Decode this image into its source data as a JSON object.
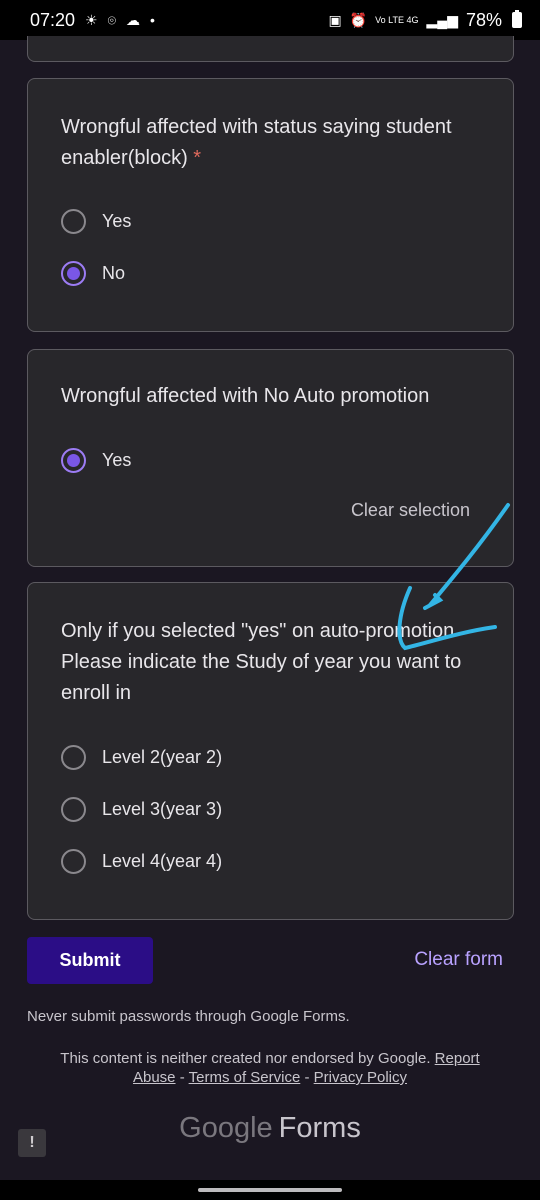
{
  "status_bar": {
    "time": "07:20",
    "network": "Vo LTE 4G",
    "battery": "78%"
  },
  "questions": [
    {
      "title": "Wrongful affected with status saying student enabler(block)",
      "required_mark": "*",
      "options": [
        {
          "label": "Yes",
          "selected": false
        },
        {
          "label": "No",
          "selected": true
        }
      ]
    },
    {
      "title": "Wrongful affected with No Auto promotion",
      "options": [
        {
          "label": "Yes",
          "selected": true
        }
      ],
      "clear_selection": "Clear selection"
    },
    {
      "title": "Only if you selected \"yes\" on auto-promotion Please indicate the Study of year you want to enroll in",
      "options": [
        {
          "label": "Level 2(year 2)",
          "selected": false
        },
        {
          "label": "Level 3(year 3)",
          "selected": false
        },
        {
          "label": "Level 4(year 4)",
          "selected": false
        }
      ]
    }
  ],
  "actions": {
    "submit": "Submit",
    "clear_form": "Clear form"
  },
  "footer": {
    "password_notice": "Never submit passwords through Google Forms.",
    "disclaimer": "This content is neither created nor endorsed by Google.",
    "report_abuse": "Report Abuse",
    "terms": "Terms of Service",
    "privacy": "Privacy Policy",
    "separator": "-",
    "logo_google": "Google",
    "logo_forms": "Forms"
  },
  "colors": {
    "accent": "#7a57e6",
    "submit_bg": "#2b0d86",
    "annotation": "#33b5e5"
  }
}
